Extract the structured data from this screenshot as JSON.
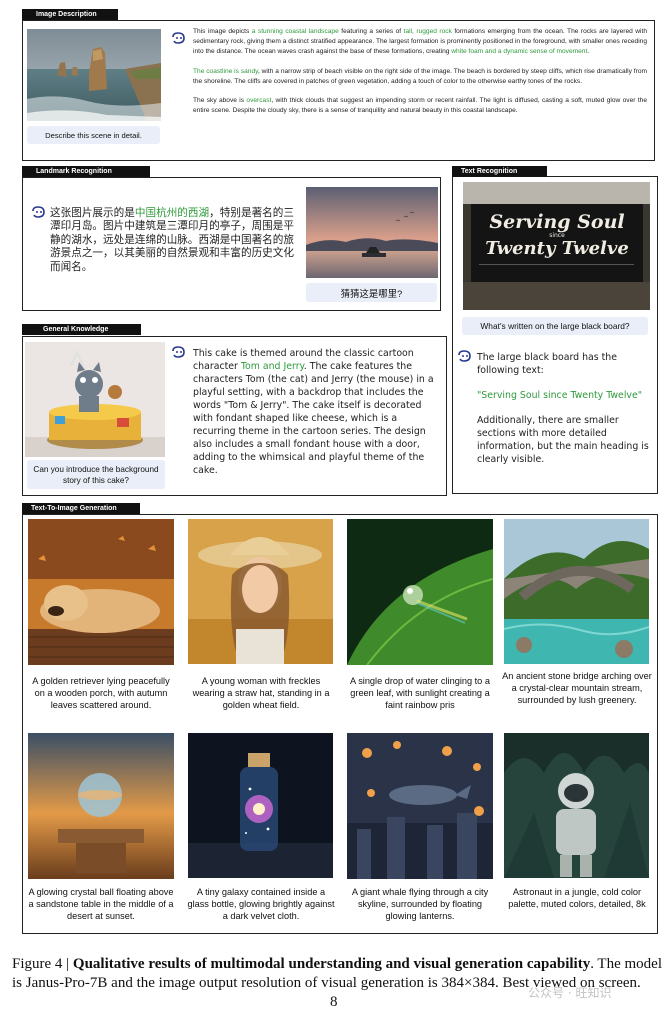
{
  "panels": {
    "image_description": {
      "tab": "Image Description",
      "question": "Describe this scene in detail.",
      "p1": {
        "a": "This image depicts ",
        "g1": "a stunning coastal landscape",
        "b": " featuring a series of ",
        "g2": "tall, rugged rock",
        "c": " formations emerging from the ocean. The rocks are layered with sedimentary rock, giving them a distinct stratified appearance. The largest formation is prominently positioned in the foreground, with smaller ones receding into the distance. The ocean waves crash against the base of these formations, creating ",
        "g3": "white foam and a dynamic sense of movement",
        "d": "."
      },
      "p2": {
        "g1": "The coastline is sandy",
        "a": ", with a narrow strip of beach visible on the right side of the image. The beach is bordered by steep cliffs, which rise dramatically from the shoreline. The cliffs are covered in patches of green vegetation, adding a touch of color to the otherwise earthy tones of the rocks."
      },
      "p3": {
        "a": "The sky above is ",
        "g1": "overcast",
        "b": ", with thick clouds that suggest an impending storm or recent rainfall. The light is diffused, casting a soft, muted glow over the entire scene. Despite the cloudy sky, there is a sense of tranquility and natural beauty in this coastal landscape."
      }
    },
    "landmark_recognition": {
      "tab": "Landmark Recognition",
      "answer_a": "这张图片展示的是",
      "answer_g": "中国杭州的西湖",
      "answer_b": "，特别是著名的三潭印月岛。图片中建筑是三潭印月的亭子，周围是平静的湖水，远处是连绵的山脉。西湖是中国著名的旅游景点之一，以其美丽的自然景观和丰富的历史文化而闻名。",
      "question": "猜猜这是哪里?"
    },
    "text_recognition": {
      "tab": "Text Recognition",
      "board_line1": "Serving Soul",
      "board_line2": "since",
      "board_line3": "Twenty Twelve",
      "question": "What's written on the large black board?",
      "answer_intro": "The large black board has the following text:",
      "answer_quote": "\"Serving Soul since Twenty Twelve\"",
      "answer_more": "Additionally, there are smaller sections with more detailed information, but the main heading is clearly visible."
    },
    "general_knowledge": {
      "tab": "General Knowledge",
      "question": "Can you introduce the background story of this cake?",
      "answer_a": "This cake is themed around the classic cartoon character ",
      "answer_g": "Tom and Jerry",
      "answer_b": ". The cake features the characters Tom (the cat) and Jerry (the mouse) in a playful setting, with a backdrop that includes the words \"Tom & Jerry\". The cake itself is decorated with fondant shaped like cheese, which is a recurring theme in the cartoon series. The design also includes a small fondant house with a door, adding to the whimsical and playful theme of the cake."
    },
    "text_to_image": {
      "tab": "Text-To-Image Generation",
      "items": [
        "A golden retriever lying peacefully on a wooden porch, with autumn leaves scattered around.",
        "A young woman with freckles wearing a straw hat, standing in a golden wheat field.",
        "A single drop of water clinging to a green leaf, with sunlight creating a faint rainbow pris",
        "An ancient stone bridge arching over a crystal-clear mountain stream, surrounded by lush greenery.",
        "A glowing crystal ball floating above a sandstone table in the middle of a desert at sunset.",
        "A tiny galaxy contained inside a glass bottle, glowing brightly against a dark velvet cloth.",
        "A giant whale flying through a city skyline, surrounded by floating glowing lanterns.",
        "Astronaut in a jungle, cold color palette, muted colors, detailed, 8k"
      ]
    }
  },
  "figure_caption": {
    "label": "Figure 4 | ",
    "bold": "Qualitative results of multimodal understanding and visual generation capability",
    "rest": ". The model is Janus-Pro-7B and the image output resolution of visual generation is 384×384. Best viewed on screen."
  },
  "page_number": "8",
  "watermark": "公众号 · 旺知识",
  "colors": {
    "accent_green": "#2f9a3c",
    "question_bg": "#e9eef8",
    "tab_bg": "#111111",
    "icon_blue": "#2b3a8f"
  }
}
